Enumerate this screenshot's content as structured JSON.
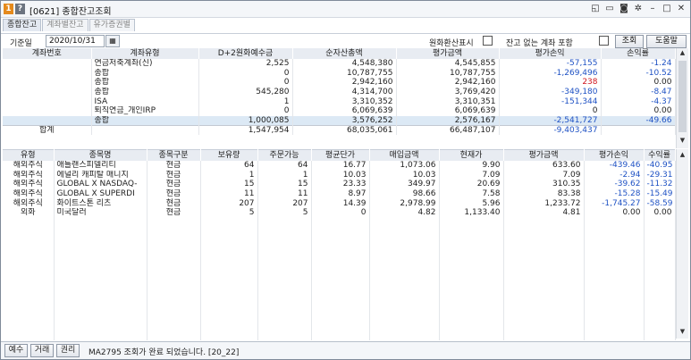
{
  "window": {
    "number_badge": "1",
    "help_badge": "?",
    "title": "[0621] 종합잔고조회"
  },
  "titlebar_icons": [
    "restore-small-icon",
    "screen-icon",
    "camera-icon",
    "gear-icon",
    "minimize-icon",
    "maximize-icon",
    "close-icon"
  ],
  "tabs": [
    {
      "label": "종합잔고"
    },
    {
      "label": "계좌별잔고"
    },
    {
      "label": "유가증권별"
    }
  ],
  "filter": {
    "date_label": "기준일",
    "date_value": "2020/10/31",
    "fx_label": "원화환산표시",
    "no_balance_label": "잔고 없는 계좌 포함",
    "search_button": "조회",
    "help_button": "도움말"
  },
  "accounts": {
    "headers": [
      "계좌번호",
      "계좌유형",
      "D+2원화예수금",
      "순자산총액",
      "평가금액",
      "평가손익",
      "손익률"
    ],
    "rows": [
      {
        "acct": "",
        "type": "연금저축계좌(신)",
        "deposit": "2,525",
        "net": "4,548,380",
        "eval": "4,545,855",
        "pnl": "-57,155",
        "rate": "-1.24"
      },
      {
        "acct": "",
        "type": "종합",
        "deposit": "0",
        "net": "10,787,755",
        "eval": "10,787,755",
        "pnl": "-1,269,496",
        "rate": "-10.52"
      },
      {
        "acct": "",
        "type": "종합",
        "deposit": "0",
        "net": "2,942,160",
        "eval": "2,942,160",
        "pnl": "238",
        "rate": "0.00"
      },
      {
        "acct": "",
        "type": "종합",
        "deposit": "545,280",
        "net": "4,314,700",
        "eval": "3,769,420",
        "pnl": "-349,180",
        "rate": "-8.47"
      },
      {
        "acct": "",
        "type": "ISA",
        "deposit": "1",
        "net": "3,310,352",
        "eval": "3,310,351",
        "pnl": "-151,344",
        "rate": "-4.37"
      },
      {
        "acct": "",
        "type": "퇴직연금_개인IRP",
        "deposit": "0",
        "net": "6,069,639",
        "eval": "6,069,639",
        "pnl": "0",
        "rate": "0.00"
      },
      {
        "acct": "",
        "type": "종합",
        "deposit": "1,000,085",
        "net": "3,576,252",
        "eval": "2,576,167",
        "pnl": "-2,541,727",
        "rate": "-49.66"
      }
    ],
    "total": {
      "label": "합계",
      "deposit": "1,547,954",
      "net": "68,035,061",
      "eval": "66,487,107",
      "pnl": "-9,403,437",
      "rate": ""
    }
  },
  "holdings": {
    "headers": [
      "유형",
      "종목명",
      "종목구분",
      "보유량",
      "주문가능",
      "평균단가",
      "매입금액",
      "현재가",
      "평가금액",
      "평가손익",
      "수익률"
    ],
    "rows": [
      {
        "kind": "해외주식",
        "name": "애틀랜스피델리티",
        "cls": "현금",
        "qty": "64",
        "avail": "64",
        "avg": "16.77",
        "buy": "1,073.06",
        "price": "9.90",
        "eval": "633.60",
        "pnl": "-439.46",
        "rate": "-40.95"
      },
      {
        "kind": "해외주식",
        "name": "에널리 캐피탈 매니지",
        "cls": "현금",
        "qty": "1",
        "avail": "1",
        "avg": "10.03",
        "buy": "10.03",
        "price": "7.09",
        "eval": "7.09",
        "pnl": "-2.94",
        "rate": "-29.31"
      },
      {
        "kind": "해외주식",
        "name": "GLOBAL X NASDAQ-",
        "cls": "현금",
        "qty": "15",
        "avail": "15",
        "avg": "23.33",
        "buy": "349.97",
        "price": "20.69",
        "eval": "310.35",
        "pnl": "-39.62",
        "rate": "-11.32"
      },
      {
        "kind": "해외주식",
        "name": "GLOBAL X SUPERDI",
        "cls": "현금",
        "qty": "11",
        "avail": "11",
        "avg": "8.97",
        "buy": "98.66",
        "price": "7.58",
        "eval": "83.38",
        "pnl": "-15.28",
        "rate": "-15.49"
      },
      {
        "kind": "해외주식",
        "name": "화이트스톤 리츠",
        "cls": "현금",
        "qty": "207",
        "avail": "207",
        "avg": "14.39",
        "buy": "2,978.99",
        "price": "5.96",
        "eval": "1,233.72",
        "pnl": "-1,745.27",
        "rate": "-58.59"
      },
      {
        "kind": "외화",
        "name": "미국달러",
        "cls": "현금",
        "qty": "5",
        "avail": "5",
        "avg": "0",
        "buy": "4.82",
        "price": "1,133.40",
        "eval": "4.81",
        "pnl": "0.00",
        "rate": "0.00"
      }
    ]
  },
  "status": {
    "btn1": "예수",
    "btn2": "거래",
    "btn3": "권리",
    "message": "MA2795 조회가 완료 되었습니다. [20_22]"
  },
  "colors": {
    "negative": "#1f52c4",
    "positive": "#d0161e",
    "selected_row": "#dce9f5",
    "header_bg": "#e8ecf2"
  }
}
